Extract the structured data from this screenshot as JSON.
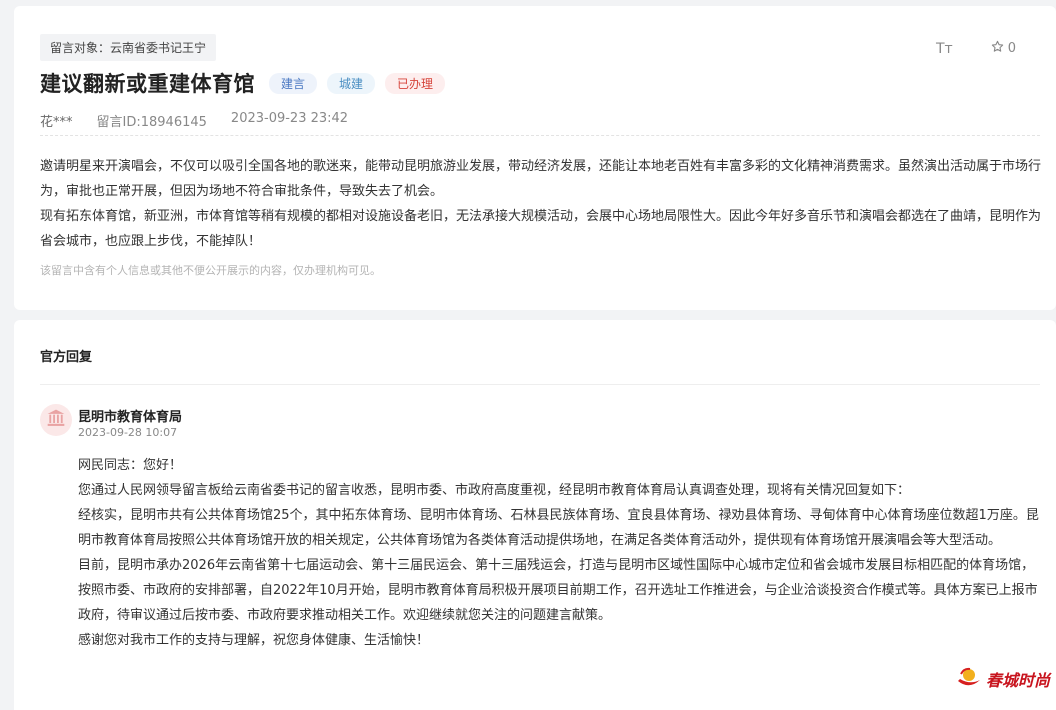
{
  "message": {
    "target": "留言对象：云南省委书记王宁",
    "title": "建议翻新或重建体育馆",
    "tags": [
      "建言",
      "城建",
      "已办理"
    ],
    "author": "花***",
    "message_id": "留言ID:18946145",
    "datetime": "2023-09-23 23:42",
    "font_tool": "Tт",
    "favorite_count": "0",
    "paragraphs": [
      "邀请明星来开演唱会，不仅可以吸引全国各地的歌迷来，能带动昆明旅游业发展，带动经济发展，还能让本地老百姓有丰富多彩的文化精神消费需求。虽然演出活动属于市场行为，审批也正常开展，但因为场地不符合审批条件，导致失去了机会。",
      "现有拓东体育馆，新亚洲，市体育馆等稍有规模的都相对设施设备老旧，无法承接大规模活动，会展中心场地局限性大。因此今年好多音乐节和演唱会都选在了曲靖，昆明作为省会城市，也应跟上步伐，不能掉队！"
    ],
    "privacy_note": "该留言中含有个人信息或其他不便公开展示的内容，仅办理机构可见。"
  },
  "reply": {
    "heading": "官方回复",
    "org": "昆明市教育体育局",
    "datetime": "2023-09-28 10:07",
    "paragraphs": [
      "网民同志：您好！",
      "您通过人民网领导留言板给云南省委书记的留言收悉，昆明市委、市政府高度重视，经昆明市教育体育局认真调查处理，现将有关情况回复如下：",
      "经核实，昆明市共有公共体育场馆25个，其中拓东体育场、昆明市体育场、石林县民族体育场、宜良县体育场、禄劝县体育场、寻甸体育中心体育场座位数超1万座。昆明市教育体育局按照公共体育场馆开放的相关规定，公共体育场馆为各类体育活动提供场地，在满足各类体育活动外，提供现有体育场馆开展演唱会等大型活动。",
      "目前，昆明市承办2026年云南省第十七届运动会、第十三届民运会、第十三届残运会，打造与昆明市区域性国际中心城市定位和省会城市发展目标相匹配的体育场馆，按照市委、市政府的安排部署，自2022年10月开始，昆明市教育体育局积极开展项目前期工作，召开选址工作推进会，与企业洽谈投资合作模式等。具体方案已上报市政府，待审议通过后按市委、市政府要求推动相关工作。欢迎继续就您关注的问题建言献策。",
      "感谢您对我市工作的支持与理解，祝您身体健康、生活愉快！"
    ]
  },
  "watermark": {
    "text": "春城时尚"
  },
  "colors": {
    "accent_red": "#d6453c",
    "tag_blue": "#4a78c2",
    "page_bg": "#f2f3f5"
  },
  "icons": {
    "font_size": "font-size-icon",
    "favorite": "star-icon",
    "avatar": "government-building-icon",
    "watermark": "sun-logo-icon"
  }
}
